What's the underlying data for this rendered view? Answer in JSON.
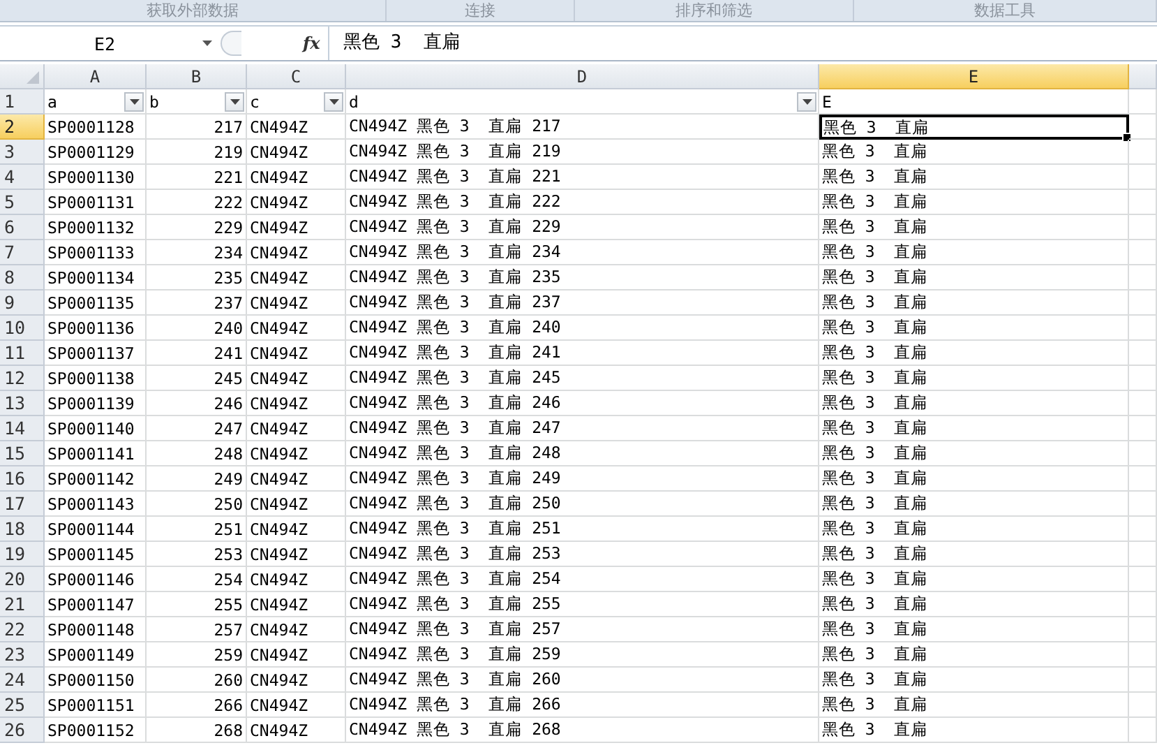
{
  "ribbon_groups": [
    "获取外部数据",
    "连接",
    "排序和筛选",
    "数据工具"
  ],
  "formula_bar": {
    "name_box": "E2",
    "fx_label": "fx",
    "content": "黑色 3  直扁"
  },
  "columns": [
    {
      "letter": "A",
      "kind": "text",
      "selected": false
    },
    {
      "letter": "B",
      "kind": "number",
      "selected": false
    },
    {
      "letter": "C",
      "kind": "text",
      "selected": false
    },
    {
      "letter": "D",
      "kind": "text",
      "selected": false
    },
    {
      "letter": "E",
      "kind": "text",
      "selected": true
    },
    {
      "kind": "text",
      "selected": false
    }
  ],
  "header_row": {
    "number": "1",
    "selected": false,
    "cells": [
      {
        "text": "a",
        "filter": true
      },
      {
        "text": "b",
        "filter": true
      },
      {
        "text": "c",
        "filter": true
      },
      {
        "text": "d",
        "filter": true
      },
      {
        "text": "E",
        "filter": false
      }
    ]
  },
  "rows": [
    {
      "number": "2",
      "selected": true,
      "cells": [
        "SP0001128",
        "217",
        "CN494Z",
        "CN494Z 黑色 3  直扁 217",
        "黑色 3  直扁"
      ]
    },
    {
      "number": "3",
      "selected": false,
      "cells": [
        "SP0001129",
        "219",
        "CN494Z",
        "CN494Z 黑色 3  直扁 219",
        "黑色 3  直扁"
      ]
    },
    {
      "number": "4",
      "selected": false,
      "cells": [
        "SP0001130",
        "221",
        "CN494Z",
        "CN494Z 黑色 3  直扁 221",
        "黑色 3  直扁"
      ]
    },
    {
      "number": "5",
      "selected": false,
      "cells": [
        "SP0001131",
        "222",
        "CN494Z",
        "CN494Z 黑色 3  直扁 222",
        "黑色 3  直扁"
      ]
    },
    {
      "number": "6",
      "selected": false,
      "cells": [
        "SP0001132",
        "229",
        "CN494Z",
        "CN494Z 黑色 3  直扁 229",
        "黑色 3  直扁"
      ]
    },
    {
      "number": "7",
      "selected": false,
      "cells": [
        "SP0001133",
        "234",
        "CN494Z",
        "CN494Z 黑色 3  直扁 234",
        "黑色 3  直扁"
      ]
    },
    {
      "number": "8",
      "selected": false,
      "cells": [
        "SP0001134",
        "235",
        "CN494Z",
        "CN494Z 黑色 3  直扁 235",
        "黑色 3  直扁"
      ]
    },
    {
      "number": "9",
      "selected": false,
      "cells": [
        "SP0001135",
        "237",
        "CN494Z",
        "CN494Z 黑色 3  直扁 237",
        "黑色 3  直扁"
      ]
    },
    {
      "number": "10",
      "selected": false,
      "cells": [
        "SP0001136",
        "240",
        "CN494Z",
        "CN494Z 黑色 3  直扁 240",
        "黑色 3  直扁"
      ]
    },
    {
      "number": "11",
      "selected": false,
      "cells": [
        "SP0001137",
        "241",
        "CN494Z",
        "CN494Z 黑色 3  直扁 241",
        "黑色 3  直扁"
      ]
    },
    {
      "number": "12",
      "selected": false,
      "cells": [
        "SP0001138",
        "245",
        "CN494Z",
        "CN494Z 黑色 3  直扁 245",
        "黑色 3  直扁"
      ]
    },
    {
      "number": "13",
      "selected": false,
      "cells": [
        "SP0001139",
        "246",
        "CN494Z",
        "CN494Z 黑色 3  直扁 246",
        "黑色 3  直扁"
      ]
    },
    {
      "number": "14",
      "selected": false,
      "cells": [
        "SP0001140",
        "247",
        "CN494Z",
        "CN494Z 黑色 3  直扁 247",
        "黑色 3  直扁"
      ]
    },
    {
      "number": "15",
      "selected": false,
      "cells": [
        "SP0001141",
        "248",
        "CN494Z",
        "CN494Z 黑色 3  直扁 248",
        "黑色 3  直扁"
      ]
    },
    {
      "number": "16",
      "selected": false,
      "cells": [
        "SP0001142",
        "249",
        "CN494Z",
        "CN494Z 黑色 3  直扁 249",
        "黑色 3  直扁"
      ]
    },
    {
      "number": "17",
      "selected": false,
      "cells": [
        "SP0001143",
        "250",
        "CN494Z",
        "CN494Z 黑色 3  直扁 250",
        "黑色 3  直扁"
      ]
    },
    {
      "number": "18",
      "selected": false,
      "cells": [
        "SP0001144",
        "251",
        "CN494Z",
        "CN494Z 黑色 3  直扁 251",
        "黑色 3  直扁"
      ]
    },
    {
      "number": "19",
      "selected": false,
      "cells": [
        "SP0001145",
        "253",
        "CN494Z",
        "CN494Z 黑色 3  直扁 253",
        "黑色 3  直扁"
      ]
    },
    {
      "number": "20",
      "selected": false,
      "cells": [
        "SP0001146",
        "254",
        "CN494Z",
        "CN494Z 黑色 3  直扁 254",
        "黑色 3  直扁"
      ]
    },
    {
      "number": "21",
      "selected": false,
      "cells": [
        "SP0001147",
        "255",
        "CN494Z",
        "CN494Z 黑色 3  直扁 255",
        "黑色 3  直扁"
      ]
    },
    {
      "number": "22",
      "selected": false,
      "cells": [
        "SP0001148",
        "257",
        "CN494Z",
        "CN494Z 黑色 3  直扁 257",
        "黑色 3  直扁"
      ]
    },
    {
      "number": "23",
      "selected": false,
      "cells": [
        "SP0001149",
        "259",
        "CN494Z",
        "CN494Z 黑色 3  直扁 259",
        "黑色 3  直扁"
      ]
    },
    {
      "number": "24",
      "selected": false,
      "cells": [
        "SP0001150",
        "260",
        "CN494Z",
        "CN494Z 黑色 3  直扁 260",
        "黑色 3  直扁"
      ]
    },
    {
      "number": "25",
      "selected": false,
      "cells": [
        "SP0001151",
        "266",
        "CN494Z",
        "CN494Z 黑色 3  直扁 266",
        "黑色 3  直扁"
      ]
    },
    {
      "number": "26",
      "selected": false,
      "cells": [
        "SP0001152",
        "268",
        "CN494Z",
        "CN494Z 黑色 3  直扁 268",
        "黑色 3  直扁"
      ]
    }
  ]
}
